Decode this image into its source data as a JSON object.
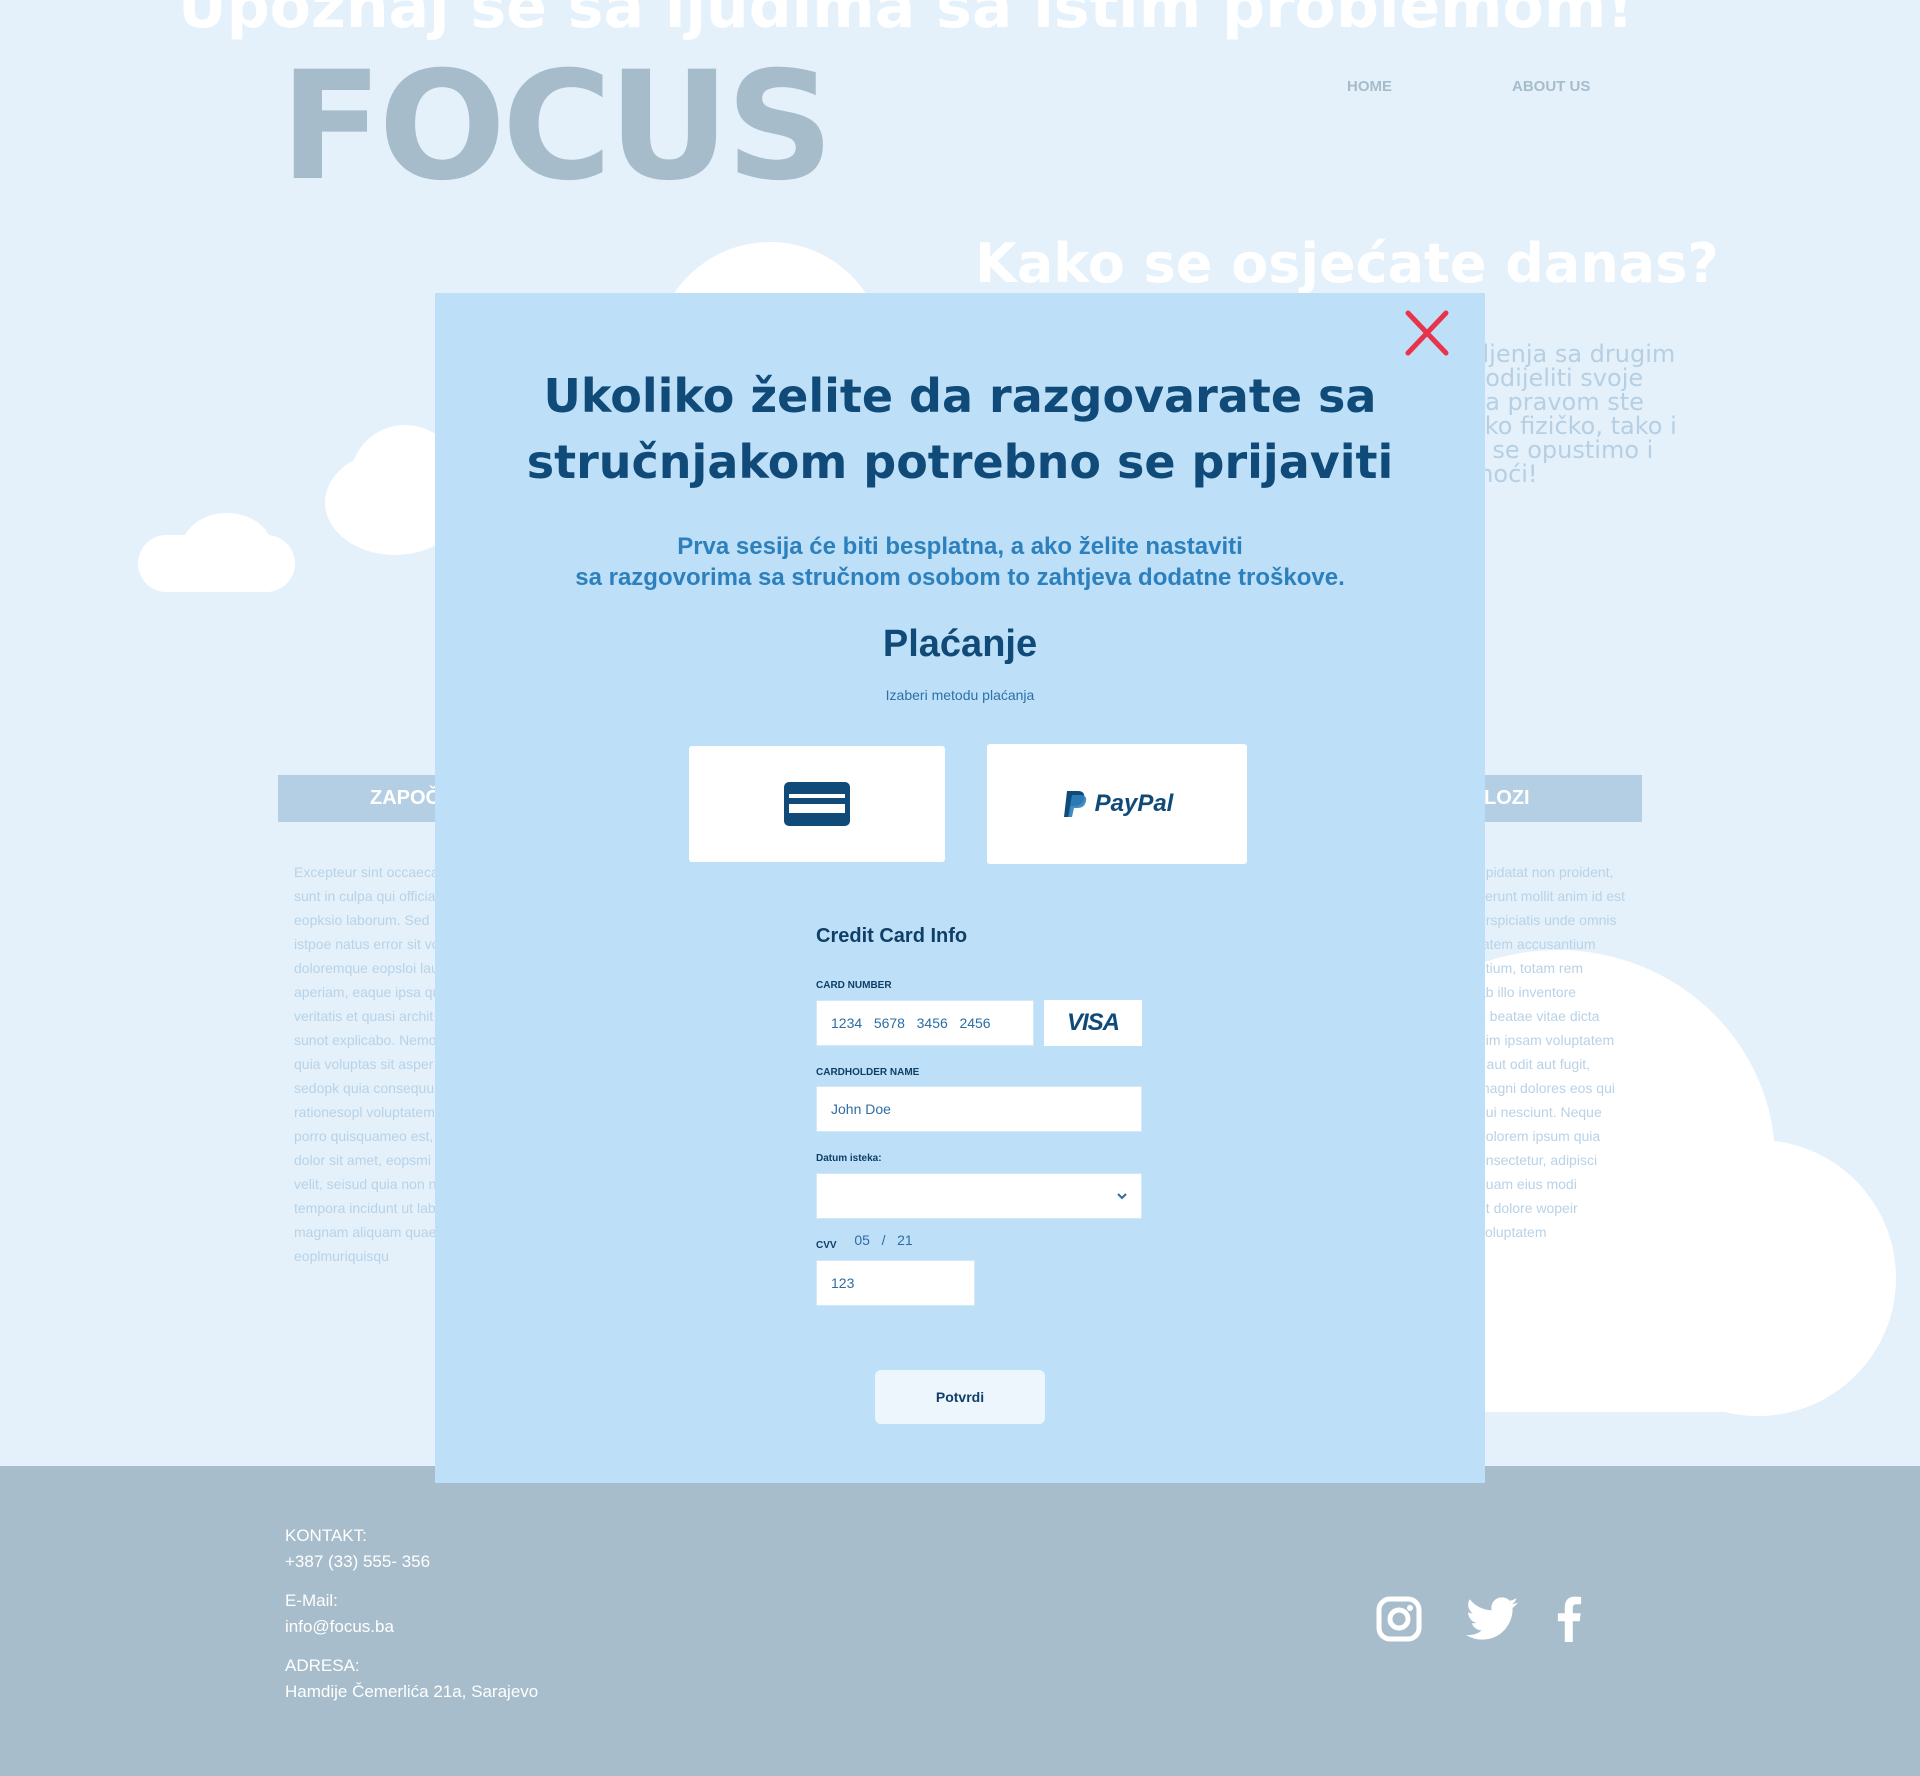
{
  "background": {
    "hero_heading": "Upoznaj se sa ljudima sa istim problemom!",
    "logo": "FOCUS",
    "nav": {
      "home": "HOME",
      "about": "ABOUT US"
    },
    "feeling_heading": "Kako se osjećate danas?",
    "feeling_lines": [
      "šljenja sa drugim",
      "podijeliti svoje",
      "na pravom ste",
      "ako fizičko, tako i",
      "a se opustimo i",
      "moći!"
    ],
    "left_bar_label": "ZAPOČ",
    "right_bar_label": "LOZI",
    "left_column_lines": [
      "Excepteur sint occaeca",
      "sunt in culpa qui officia",
      "eopksio laborum. Sed",
      "istpoe natus error sit vo",
      "doloremque eopsloi lau",
      "aperiam, eaque ipsa qu",
      "veritatis et quasi archit",
      "sunot explicabo. Nemo",
      "quia voluptas sit asper",
      "sedopk quia consequu",
      "rationesopl voluptatem",
      "porro quisquameo est,",
      "dolor sit amet, eopsmi",
      "velit, seisud quia non n",
      "tempora incidunt ut lab",
      "magnam aliquam quae",
      "eoplmuriquisqu"
    ],
    "right_column_lines": [
      "upidatat non proident,",
      "serunt mollit anim id est",
      "erspiciatis unde omnis",
      "tatem accusantium",
      "ntium, totam rem",
      "ab illo inventore",
      "o beatae vitae dicta",
      "nim ipsam voluptatem",
      "r aut odit aut fugit,",
      "magni dolores eos qui",
      "qui nesciunt. Neque",
      "dolorem ipsum quia",
      "onsectetur, adipisci",
      "quam eius modi",
      "et dolore wopeir",
      "voluptatem"
    ]
  },
  "footer": {
    "contact_label": "KONTAKT:",
    "contact_value": "+387 (33) 555- 356",
    "email_label": "E-Mail:",
    "email_value": "info@focus.ba",
    "address_label": "ADRESA:",
    "address_value": "Hamdije Čemerlića 21a, Sarajevo",
    "social_icons": [
      "instagram-icon",
      "twitter-icon",
      "facebook-icon"
    ]
  },
  "modal": {
    "title_line1": "Ukoliko želite da razgovarate sa",
    "title_line2": "stručnjakom potrebno se prijaviti",
    "subtitle_line1": "Prva sesija će biti besplatna, a ako želite nastaviti",
    "subtitle_line2": "sa razgovorima sa stručnom osobom to zahtjeva dodatne troškove.",
    "payment_heading": "Plaćanje",
    "payment_hint": "Izaberi metodu plaćanja",
    "paypal_label": "PayPal",
    "cc_title": "Credit Card Info",
    "card_number_label": "CARD NUMBER",
    "card_number_value": "1234   5678   3456   2456",
    "card_brand": "VISA",
    "cardholder_label": "CARDHOLDER NAME",
    "cardholder_value": "John Doe",
    "expiry_label": "Datum isteka:",
    "expiry_value": "05   /   21",
    "cvv_label": "CVV",
    "cvv_value": "123",
    "confirm_label": "Potvrdi"
  },
  "colors": {
    "page_bg": "#e4f1fb",
    "modal_bg": "#bde0f8",
    "primary_text": "#0f4a78",
    "accent_text": "#2d80bc",
    "close_red": "#e8334a",
    "footer_bg": "#a7bdcb"
  }
}
